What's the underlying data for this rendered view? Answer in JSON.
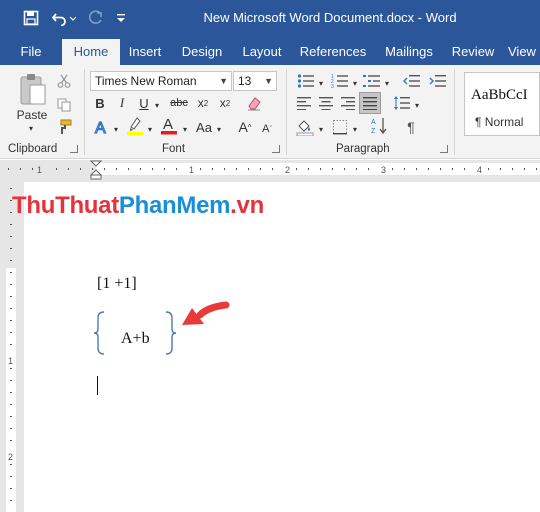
{
  "window": {
    "title": "New Microsoft Word Document.docx  -  Word"
  },
  "tabs": [
    "File",
    "Home",
    "Insert",
    "Design",
    "Layout",
    "References",
    "Mailings",
    "Review",
    "View"
  ],
  "ribbon": {
    "clipboard": {
      "label": "Clipboard",
      "paste_label": "Paste"
    },
    "font": {
      "label": "Font",
      "font_name": "Times New Roman",
      "font_size": "13"
    },
    "paragraph": {
      "label": "Paragraph"
    },
    "styles": {
      "preview": "AaBbCcI",
      "style_name": "¶ Normal"
    }
  },
  "ruler": {
    "numbers": [
      "1",
      "1",
      "2",
      "3",
      "4"
    ]
  },
  "vruler": {
    "numbers": [
      "1",
      "2"
    ]
  },
  "watermark": {
    "part1": "ThuThuat",
    "part2": "PhanMem",
    "part3": ".vn"
  },
  "document": {
    "line1": "[1 +1]",
    "line2": "A+b"
  },
  "colors": {
    "accent": "#2b579a",
    "arrow": "#e83a3a",
    "brace": "#4a7ab0"
  }
}
